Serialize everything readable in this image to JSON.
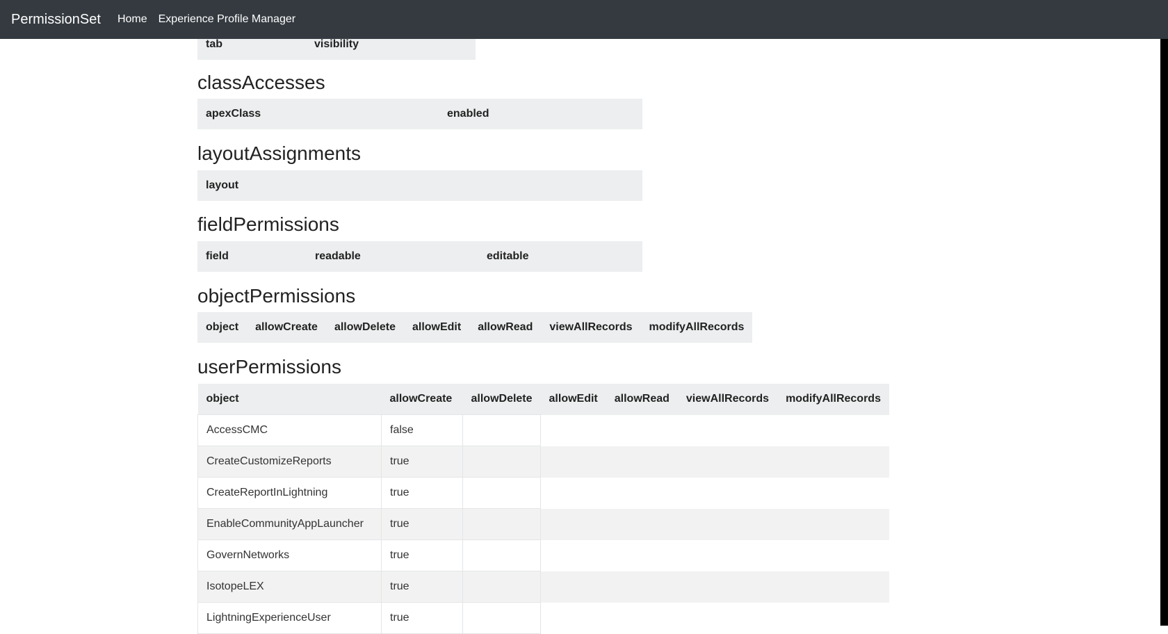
{
  "navbar": {
    "brand": "PermissionSet",
    "links": [
      "Home",
      "Experience Profile Manager"
    ]
  },
  "sections": {
    "tabSettings": {
      "headers": [
        "tab",
        "visibility"
      ]
    },
    "classAccesses": {
      "title": "classAccesses",
      "headers": [
        "apexClass",
        "enabled"
      ]
    },
    "layoutAssignments": {
      "title": "layoutAssignments",
      "headers": [
        "layout"
      ]
    },
    "fieldPermissions": {
      "title": "fieldPermissions",
      "headers": [
        "field",
        "readable",
        "editable"
      ]
    },
    "objectPermissions": {
      "title": "objectPermissions",
      "headers": [
        "object",
        "allowCreate",
        "allowDelete",
        "allowEdit",
        "allowRead",
        "viewAllRecords",
        "modifyAllRecords"
      ]
    },
    "userPermissions": {
      "title": "userPermissions",
      "headers": [
        "object",
        "allowCreate",
        "allowDelete",
        "allowEdit",
        "allowRead",
        "viewAllRecords",
        "modifyAllRecords"
      ],
      "rows": [
        [
          "AccessCMC",
          "false"
        ],
        [
          "CreateCustomizeReports",
          "true"
        ],
        [
          "CreateReportInLightning",
          "true"
        ],
        [
          "EnableCommunityAppLauncher",
          "true"
        ],
        [
          "GovernNetworks",
          "true"
        ],
        [
          "IsotopeLEX",
          "true"
        ],
        [
          "LightningExperienceUser",
          "true"
        ]
      ]
    }
  }
}
